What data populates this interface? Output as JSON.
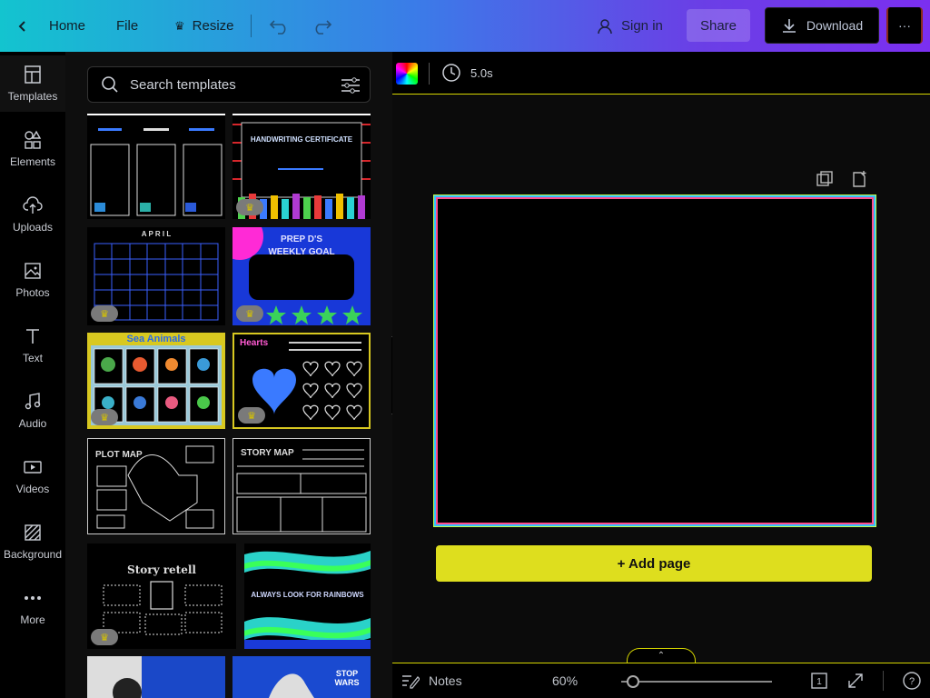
{
  "topbar": {
    "home_label": "Home",
    "file_label": "File",
    "resize_label": "Resize",
    "signin_label": "Sign in",
    "share_label": "Share",
    "download_label": "Download",
    "more_label": "···"
  },
  "rail": {
    "items": [
      {
        "label": "Templates",
        "icon": "templates-icon"
      },
      {
        "label": "Elements",
        "icon": "elements-icon"
      },
      {
        "label": "Uploads",
        "icon": "upload-icon"
      },
      {
        "label": "Photos",
        "icon": "photo-icon"
      },
      {
        "label": "Text",
        "icon": "text-icon"
      },
      {
        "label": "Audio",
        "icon": "music-icon"
      },
      {
        "label": "Videos",
        "icon": "video-icon"
      },
      {
        "label": "Background",
        "icon": "background-icon"
      },
      {
        "label": "More",
        "icon": "more-icon"
      }
    ]
  },
  "panel": {
    "search_placeholder": "Search templates",
    "templates": {
      "t2_title": "HANDWRITING CERTIFICATE",
      "t3_title": "A P R I L",
      "t4_title_1": "PREP D'S",
      "t4_title_2": "WEEKLY GOAL",
      "t5_title": "Sea Animals",
      "t6_title": "Hearts",
      "t7_title": "PLOT MAP",
      "t8_title": "STORY MAP",
      "t9_title": "Story retell",
      "t10_title": "ALWAYS LOOK FOR RAINBOWS",
      "t12_title": "STOP WARS"
    }
  },
  "toolbar2": {
    "duration": "5.0s"
  },
  "canvas": {
    "add_page_label": "+ Add page"
  },
  "footer": {
    "notes_label": "Notes",
    "zoom_value": "60%",
    "zoom_fraction": 0.08,
    "page_count": "1"
  },
  "colors": {
    "topbar_start": "#13c4cf",
    "topbar_end": "#7b2ff0",
    "add_page": "#dede1e",
    "accent_line": "#d6d600"
  }
}
